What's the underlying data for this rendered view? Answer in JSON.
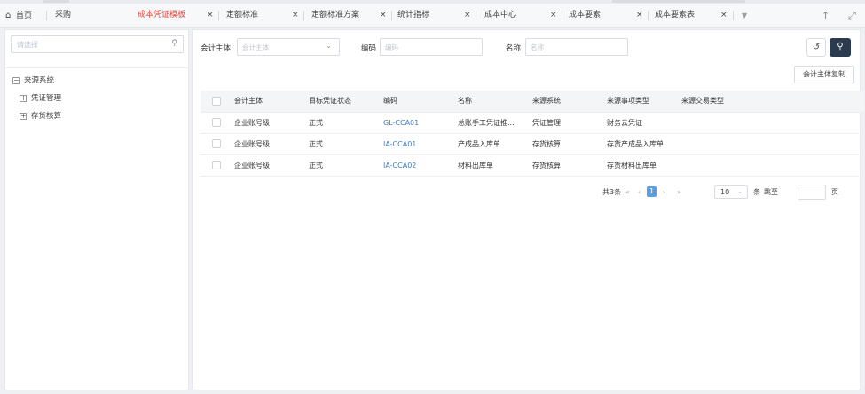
{
  "tabs": [
    {
      "label": "首页",
      "icon": "home-icon",
      "closable": false,
      "active": false
    },
    {
      "label": "采购",
      "closable": false,
      "active": false
    },
    {
      "label": "成本凭证模板",
      "closable": true,
      "active": true
    },
    {
      "label": "定额标准",
      "closable": true,
      "active": false
    },
    {
      "label": "定额标准方案",
      "closable": true,
      "active": false
    },
    {
      "label": "统计指标",
      "closable": true,
      "active": false
    },
    {
      "label": "成本中心",
      "closable": true,
      "active": false
    },
    {
      "label": "成本要素",
      "closable": true,
      "active": false
    },
    {
      "label": "成本要素表",
      "closable": true,
      "active": false
    }
  ],
  "glyphs": {
    "close": "×",
    "more": "▼",
    "up": "↑",
    "expand": "⤢",
    "home": "⌂",
    "search": "⚲",
    "reset": "↺",
    "query": "⚲",
    "chevron": "⌄"
  },
  "sidebar": {
    "search_placeholder": "请选择",
    "tree": [
      {
        "label": "来源系统",
        "toggle": "−"
      },
      {
        "label": "凭证管理",
        "toggle": "+"
      },
      {
        "label": "存货核算",
        "toggle": "+"
      }
    ]
  },
  "filters": {
    "entity_label": "会计主体",
    "entity_placeholder": "会计主体",
    "code_label": "编码",
    "code_placeholder": "编码",
    "name_label": "名称",
    "name_placeholder": "名称"
  },
  "actions": {
    "copy_label": "会计主体复制"
  },
  "table": {
    "columns": [
      "会计主体",
      "目标凭证状态",
      "编码",
      "名称",
      "来源系统",
      "来源事项类型",
      "来源交易类型"
    ],
    "rows": [
      [
        "企业账号级",
        "正式",
        "GL-CCA01",
        "总账手工凭证推...",
        "凭证管理",
        "财务云凭证",
        ""
      ],
      [
        "企业账号级",
        "正式",
        "IA-CCA01",
        "产成品入库单",
        "存货核算",
        "存货产成品入库单",
        ""
      ],
      [
        "企业账号级",
        "正式",
        "IA-CCA02",
        "材料出库单",
        "存货核算",
        "存货材料出库单",
        ""
      ]
    ]
  },
  "pagination": {
    "total_text": "共3条",
    "first": "«",
    "prev": "‹",
    "current_page": "1",
    "next": "›",
    "last": "»",
    "page_size": "10",
    "unit": "条",
    "jump_label": "跳至",
    "page_unit": "页"
  }
}
